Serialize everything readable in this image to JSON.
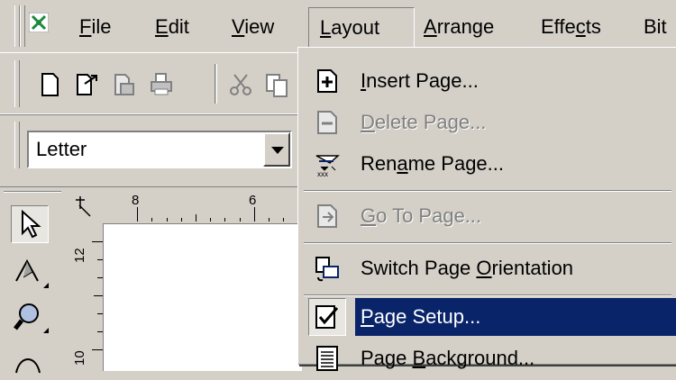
{
  "menubar": {
    "items": [
      {
        "label": "File",
        "mnemonic": "F",
        "rest": "ile"
      },
      {
        "label": "Edit",
        "mnemonic": "E",
        "rest": "dit"
      },
      {
        "label": "View",
        "mnemonic": "V",
        "rest": "iew"
      },
      {
        "label": "Layout",
        "mnemonic": "L",
        "rest": "ayout"
      },
      {
        "label": "Arrange",
        "mnemonic": "A",
        "rest": "rrange"
      },
      {
        "label": "Effects",
        "pre": "Effe",
        "mnemonic": "c",
        "rest": "ts"
      },
      {
        "label": "Bitmaps",
        "visible": "Bit"
      }
    ]
  },
  "propbar": {
    "paper_size": "Letter"
  },
  "ruler": {
    "h_labels": [
      "8",
      "6"
    ],
    "v_labels": [
      "12",
      "10"
    ]
  },
  "layout_menu": {
    "items": [
      {
        "pre": "",
        "mnemonic": "I",
        "rest": "nsert Page...",
        "icon": "insert-page-icon",
        "state": "enabled"
      },
      {
        "pre": "",
        "mnemonic": "D",
        "rest": "elete Page...",
        "icon": "delete-page-icon",
        "state": "disabled"
      },
      {
        "pre": "Ren",
        "mnemonic": "a",
        "rest": "me Page...",
        "icon": "rename-page-icon",
        "state": "enabled"
      },
      {
        "pre": "",
        "mnemonic": "G",
        "rest": "o To Page...",
        "icon": "go-to-page-icon",
        "state": "disabled"
      },
      {
        "pre": "Switch Page ",
        "mnemonic": "O",
        "rest": "rientation",
        "icon": "orientation-icon",
        "state": "enabled"
      },
      {
        "pre": "",
        "mnemonic": "P",
        "rest": "age Setup...",
        "icon": "page-setup-icon",
        "state": "selected"
      },
      {
        "pre": "Page ",
        "mnemonic": "B",
        "rest": "ackground...",
        "icon": "page-background-icon",
        "state": "enabled"
      }
    ]
  },
  "colors": {
    "face": "#d4d0c8",
    "highlight": "#0a246a",
    "disabled": "#808080"
  }
}
